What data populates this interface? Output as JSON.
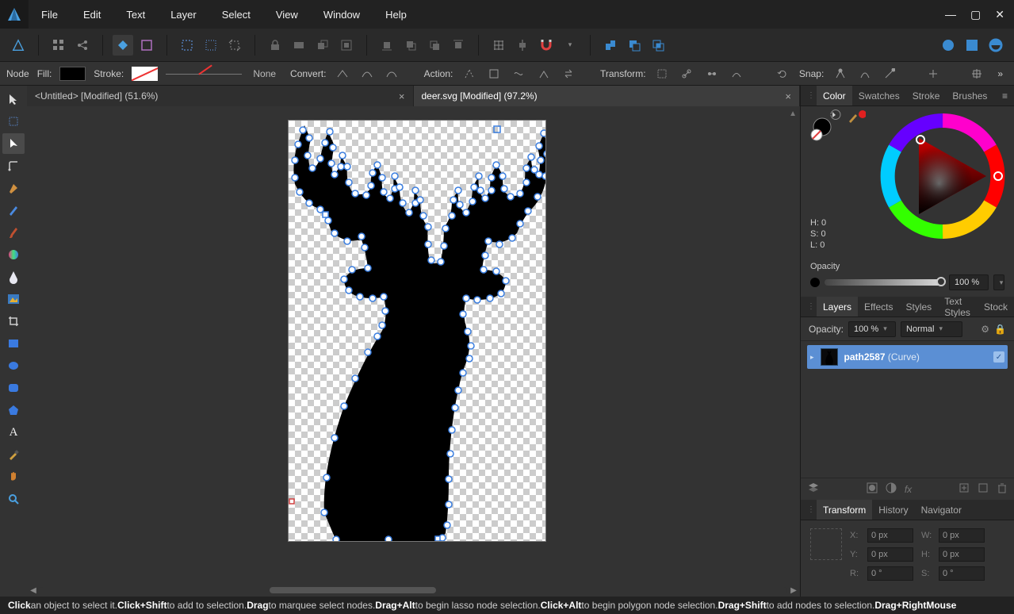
{
  "menu": {
    "items": [
      "File",
      "Edit",
      "Text",
      "Layer",
      "Select",
      "View",
      "Window",
      "Help"
    ]
  },
  "ctx": {
    "mode": "Node",
    "fill_label": "Fill:",
    "stroke_label": "Stroke:",
    "stroke_width": "None",
    "convert_label": "Convert:",
    "action_label": "Action:",
    "transform_label": "Transform:",
    "snap_label": "Snap:"
  },
  "tabs": [
    {
      "title": "<Untitled> [Modified] (51.6%)",
      "active": false
    },
    {
      "title": "deer.svg [Modified] (97.2%)",
      "active": true
    }
  ],
  "color_panel": {
    "tabs": [
      "Color",
      "Swatches",
      "Stroke",
      "Brushes"
    ],
    "active_tab": 0,
    "hsl": {
      "H": "H: 0",
      "S": "S: 0",
      "L": "L: 0"
    },
    "opacity_label": "Opacity",
    "opacity_value": "100 %"
  },
  "layers_panel": {
    "tabs": [
      "Layers",
      "Effects",
      "Styles",
      "Text Styles",
      "Stock"
    ],
    "active_tab": 0,
    "opacity_label": "Opacity:",
    "opacity_value": "100 %",
    "blend_mode": "Normal",
    "layer_name": "path2587",
    "layer_type": "(Curve)"
  },
  "transform_panel": {
    "tabs": [
      "Transform",
      "History",
      "Navigator"
    ],
    "active_tab": 0,
    "X_label": "X:",
    "X": "0 px",
    "Y_label": "Y:",
    "Y": "0 px",
    "W_label": "W:",
    "W": "0 px",
    "H_label": "H:",
    "H": "0 px",
    "R_label": "R:",
    "R": "0 °",
    "S_label": "S:",
    "S": "0 °"
  },
  "hint": {
    "p1a": "Click",
    "p1b": " an object to select it. ",
    "p2a": "Click+Shift",
    "p2b": " to add to selection. ",
    "p3a": "Drag",
    "p3b": " to marquee select nodes. ",
    "p4a": "Drag+Alt",
    "p4b": " to begin lasso node selection. ",
    "p5a": "Click+Alt",
    "p5b": " to begin polygon node selection. ",
    "p6a": "Drag+Shift",
    "p6b": " to add nodes to selection. ",
    "p7a": "Drag+RightMouse"
  }
}
